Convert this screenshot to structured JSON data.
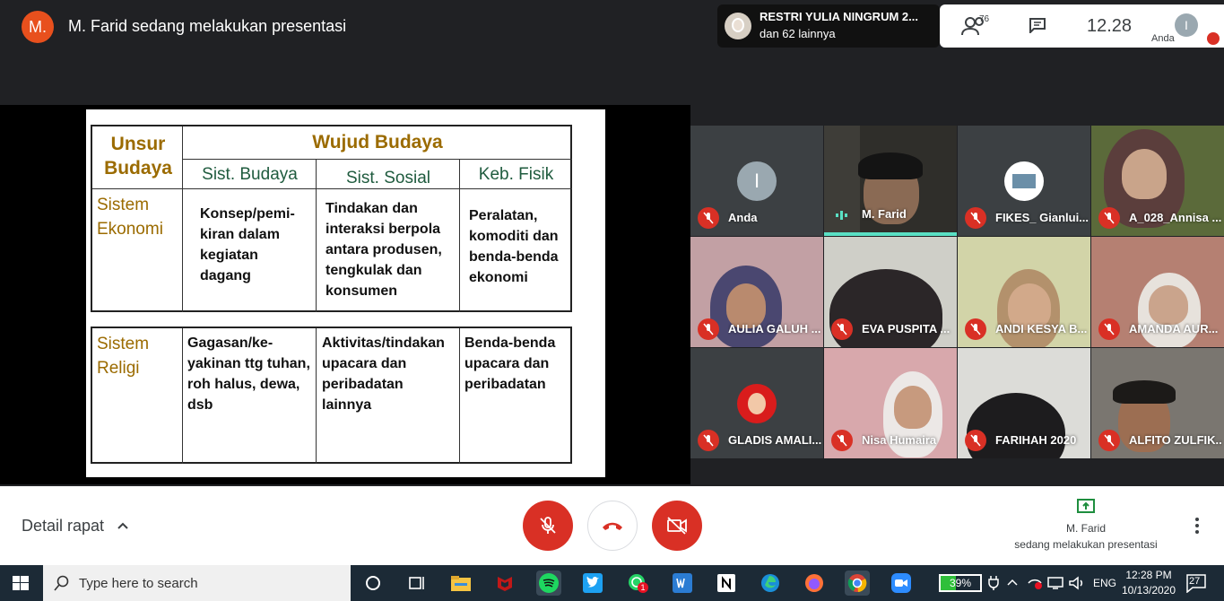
{
  "top": {
    "presenter_initial": "M.",
    "presenting_text": "M. Farid sedang melakukan presentasi",
    "people_name": "RESTRI YULIA NINGRUM 2...",
    "people_more": "dan 62 lainnya",
    "participant_count": "76",
    "time": "12.28",
    "self_initial": "I",
    "self_label": "Anda"
  },
  "slide": {
    "header_unsur": "Unsur Budaya",
    "header_wujud": "Wujud Budaya",
    "col1": "Sist. Budaya",
    "col2": "Sist. Sosial",
    "col3": "Keb. Fisik",
    "row1_head": "Sistem Ekonomi",
    "row1_c1": "Konsep/pemi-kiran dalam kegiatan dagang",
    "row1_c2": "Tindakan dan interaksi berpola antara produsen, tengkulak dan konsumen",
    "row1_c3": "Peralatan, komoditi dan benda-benda ekonomi",
    "row2_head": "Sistem Religi",
    "row2_c1": "Gagasan/ke-yakinan ttg tuhan, roh halus, dewa, dsb",
    "row2_c2": "Aktivitas/tindakan upacara dan peribadatan lainnya",
    "row2_c3": "Benda-benda upacara dan peribadatan"
  },
  "tiles": [
    {
      "name": "Anda"
    },
    {
      "name": "M. Farid"
    },
    {
      "name": "FIKES_ Gianlui..."
    },
    {
      "name": "A_028_Annisa ..."
    },
    {
      "name": "AULIA GALUH ..."
    },
    {
      "name": "EVA PUSPITA ..."
    },
    {
      "name": "ANDI KESYA B..."
    },
    {
      "name": "AMANDA AUR..."
    },
    {
      "name": "GLADIS AMALI..."
    },
    {
      "name": "Nisa Humaira"
    },
    {
      "name": "FARIHAH 2020"
    },
    {
      "name": "ALFITO ZULFIK..."
    }
  ],
  "bottom": {
    "details": "Detail rapat",
    "presenter_name": "M. Farid",
    "presenter_sub": "sedang melakukan presentasi"
  },
  "taskbar": {
    "search_placeholder": "Type here to search",
    "battery": "39%",
    "lang": "ENG",
    "time": "12:28 PM",
    "date": "10/13/2020",
    "notifications": "27",
    "mail_badge": "1"
  }
}
